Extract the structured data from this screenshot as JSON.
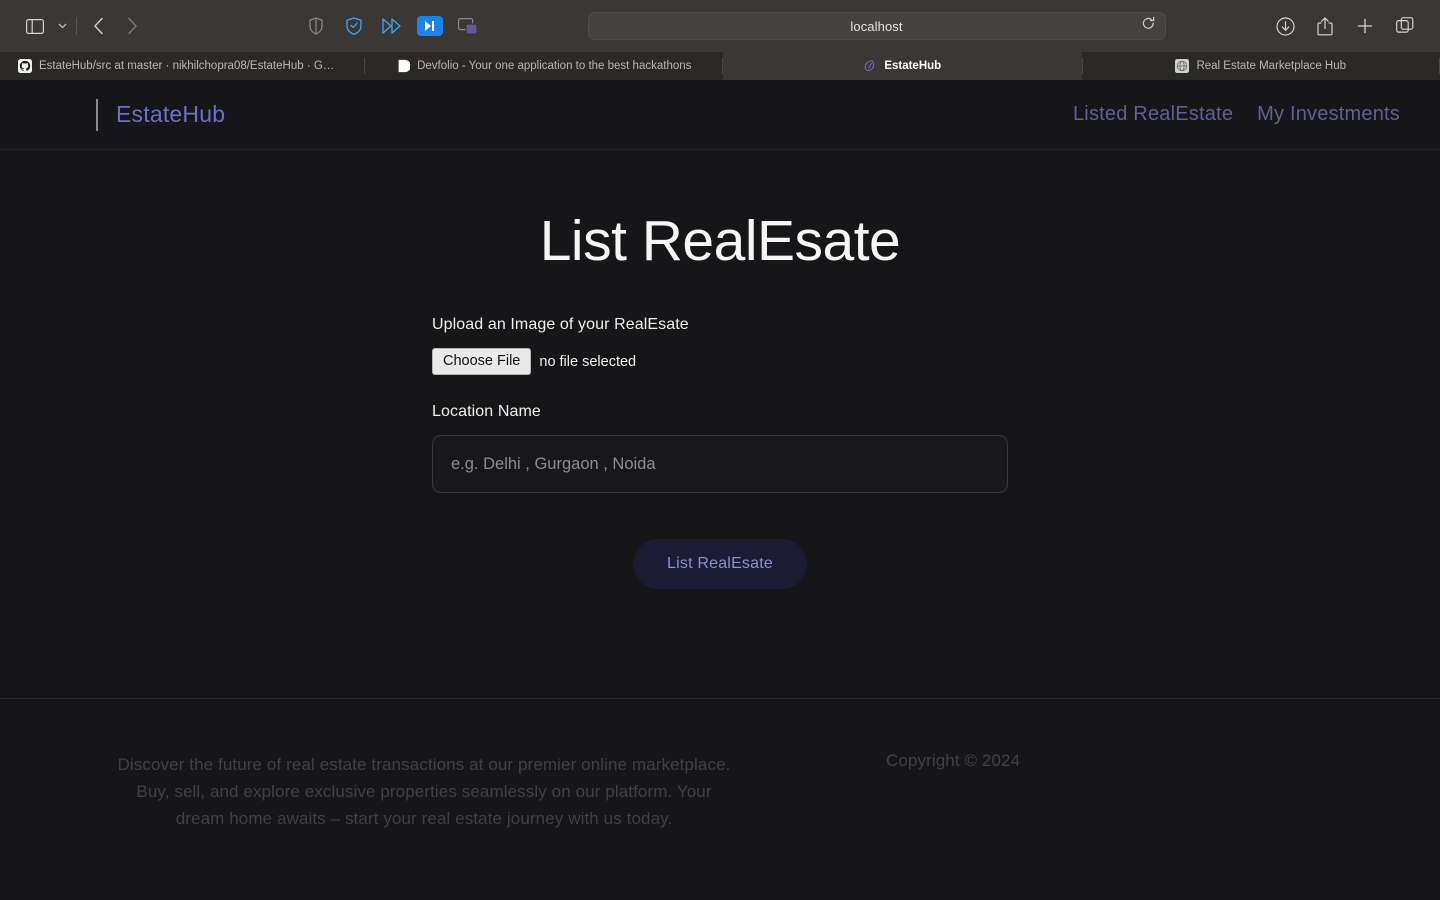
{
  "browser": {
    "toolbar": {
      "sidebar_icon": "sidebar-toggle-icon",
      "sidebar_dropdown_icon": "chevron-down-icon",
      "back_icon": "back-chevron-icon",
      "forward_icon": "forward-chevron-icon",
      "shield_icon": "shield-icon",
      "privacy_badger_icon": "privacy-badger-shield-icon",
      "fast_forward_icon": "fast-forward-icon",
      "skip_icon": "skip-forward-icon",
      "picture_in_picture_icon": "picture-in-picture-icon",
      "url": "localhost",
      "reload_icon": "reload-icon",
      "downloads_icon": "downloads-icon",
      "share_icon": "share-icon",
      "new_tab_icon": "plus-icon",
      "tab_overview_icon": "tab-overview-icon"
    },
    "tabs": [
      {
        "title": "EstateHub/src at master · nikhilchopra08/EstateHub · G…",
        "favicon": "github-icon",
        "active": false
      },
      {
        "title": "Devfolio - Your one application to the best hackathons",
        "favicon": "devfolio-icon",
        "active": false
      },
      {
        "title": "EstateHub",
        "favicon": "nextjs-leaf-icon",
        "active": true
      },
      {
        "title": "Real Estate Marketplace Hub",
        "favicon": "globe-icon",
        "active": false
      }
    ]
  },
  "site": {
    "header": {
      "brand": "EstateHub",
      "nav": [
        {
          "label": "Listed RealEstate"
        },
        {
          "label": "My Investments"
        }
      ]
    },
    "main": {
      "title": "List RealEsate",
      "upload_label": "Upload an Image of your RealEsate",
      "file_input": {
        "button_label": "Choose File",
        "status": "no file selected"
      },
      "location_label": "Location Name",
      "location_value": "",
      "location_placeholder": "e.g. Delhi , Gurgaon , Noida",
      "submit_label": "List RealEsate"
    },
    "footer": {
      "blurb": "Discover the future of real estate transactions at our premier online marketplace. Buy, sell, and explore exclusive properties seamlessly on our platform. Your dream home awaits – start your real estate journey with us today.",
      "copyright": "Copyright © 2024"
    }
  },
  "colors": {
    "page_bg": "#161618",
    "brand": "#6d6dcd",
    "nav_link": "#5f5f9a",
    "button_bg": "#1b1b33",
    "button_text": "#8d8dd4",
    "chrome_bg": "#3a3734",
    "footer_text": "#3f4049"
  }
}
